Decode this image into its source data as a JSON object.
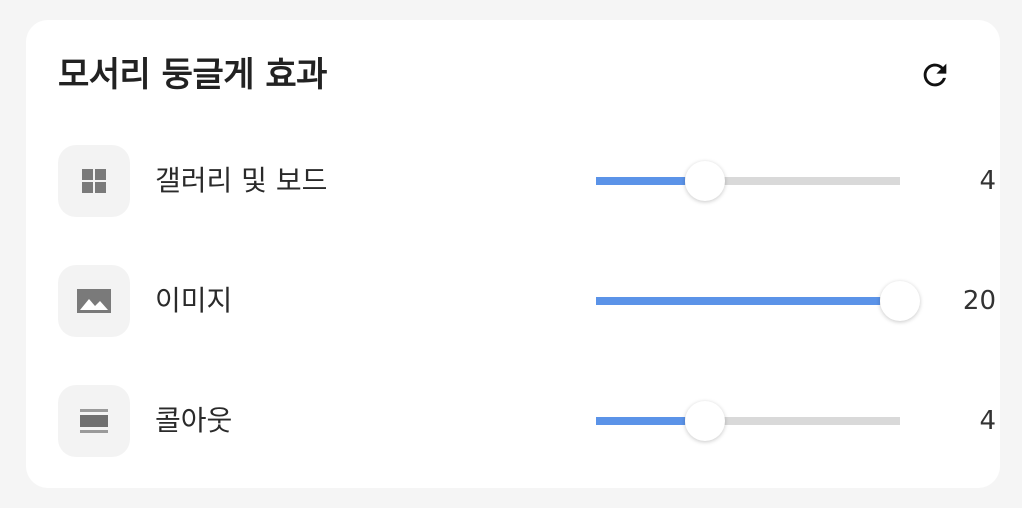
{
  "panel": {
    "title": "모서리 둥글게 효과",
    "reset_icon": "refresh-icon"
  },
  "rows": [
    {
      "icon": "grid-icon",
      "label": "갤러리 및 보드",
      "value": "4",
      "min": 0,
      "max": 20,
      "num": 4
    },
    {
      "icon": "image-icon",
      "label": "이미지",
      "value": "20",
      "min": 0,
      "max": 20,
      "num": 20
    },
    {
      "icon": "layout-icon",
      "label": "콜아웃",
      "value": "4",
      "min": 0,
      "max": 20,
      "num": 4
    }
  ],
  "colors": {
    "accent": "#5b93e8",
    "track": "#d9d9d9",
    "icon_gray": "#7a7a7a"
  }
}
